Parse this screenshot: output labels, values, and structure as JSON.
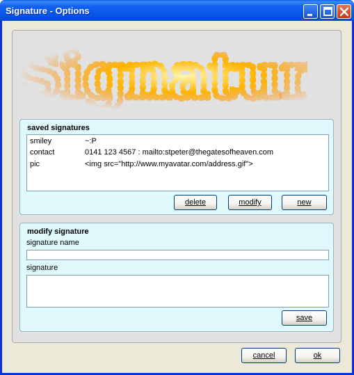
{
  "window": {
    "title": "Signature - Options"
  },
  "banner": {
    "text": "Signature"
  },
  "saved": {
    "title": "saved signatures",
    "rows": [
      {
        "name": "smiley",
        "value": "~:P"
      },
      {
        "name": "contact",
        "value": "0141 123 4567 : mailto:stpeter@thegatesofheaven.com"
      },
      {
        "name": "pic",
        "value": "<img src=\"http://www.myavatar.com/address.gif\">"
      }
    ],
    "delete_label": "delete",
    "modify_label": "modify",
    "new_label": "new"
  },
  "modify": {
    "title": "modify signature",
    "name_label": "signature name",
    "name_value": "",
    "signature_label": "signature",
    "signature_value": "",
    "save_label": "save"
  },
  "footer": {
    "cancel_label": "cancel",
    "ok_label": "ok"
  }
}
